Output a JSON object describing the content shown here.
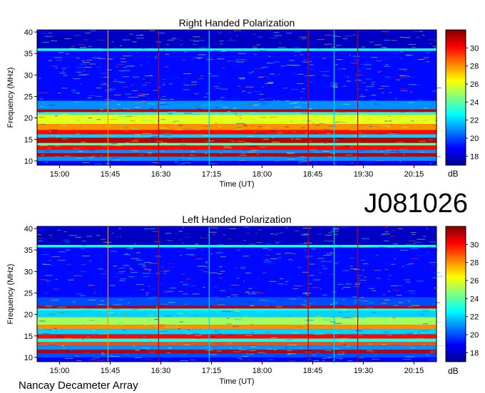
{
  "figure": {
    "observation_id": "J081026",
    "observatory": "Nancay Decameter Array"
  },
  "colorbar": {
    "label": "dB",
    "ticks": [
      18,
      20,
      22,
      24,
      26,
      28,
      30
    ],
    "range": [
      17,
      32
    ],
    "colormap": "jet"
  },
  "chart_data": [
    {
      "type": "heatmap",
      "title": "Right Handed Polarization",
      "xlabel": "Time (UT)",
      "ylabel": "Frequency (MHz)",
      "x_ticks": [
        "15:00",
        "15:45",
        "16:30",
        "17:15",
        "18:00",
        "18:45",
        "19:30",
        "20:15"
      ],
      "x_tick_minutes": [
        900,
        945,
        990,
        1035,
        1080,
        1125,
        1170,
        1215
      ],
      "xlim_minutes": [
        880,
        1235
      ],
      "y_ticks": [
        10,
        15,
        20,
        25,
        30,
        35,
        40
      ],
      "ylim": [
        9,
        40.5
      ],
      "value_unit": "dB",
      "frequency_bands": [
        {
          "fmin": 10.0,
          "fmax": 11.0,
          "dB": 21
        },
        {
          "fmin": 11.0,
          "fmax": 11.8,
          "dB": 31
        },
        {
          "fmin": 11.8,
          "fmax": 12.6,
          "dB": 21
        },
        {
          "fmin": 12.6,
          "fmax": 13.6,
          "dB": 30
        },
        {
          "fmin": 13.6,
          "fmax": 14.2,
          "dB": 24
        },
        {
          "fmin": 14.2,
          "fmax": 15.4,
          "dB": 31
        },
        {
          "fmin": 15.4,
          "fmax": 16.2,
          "dB": 22
        },
        {
          "fmin": 16.2,
          "fmax": 17.2,
          "dB": 30
        },
        {
          "fmin": 17.2,
          "fmax": 18.6,
          "dB": 28
        },
        {
          "fmin": 18.6,
          "fmax": 20.8,
          "dB": 26
        },
        {
          "fmin": 20.8,
          "fmax": 21.4,
          "dB": 23
        },
        {
          "fmin": 21.4,
          "fmax": 22.0,
          "dB": 31
        },
        {
          "fmin": 22.0,
          "fmax": 24.0,
          "dB": 21
        },
        {
          "fmin": 24.0,
          "fmax": 35.6,
          "dB": 19
        },
        {
          "fmin": 35.6,
          "fmax": 36.2,
          "dB": 23
        },
        {
          "fmin": 36.2,
          "fmax": 40.0,
          "dB": 18
        }
      ],
      "vertical_lines_minutes": [
        {
          "t": 943,
          "dB": 28
        },
        {
          "t": 988,
          "dB": 31
        },
        {
          "t": 1033,
          "dB": 22
        },
        {
          "t": 1121,
          "dB": 31
        },
        {
          "t": 1144,
          "dB": 22
        },
        {
          "t": 1165,
          "dB": 31
        }
      ]
    },
    {
      "type": "heatmap",
      "title": "Left Handed Polarization",
      "xlabel": "Time (UT)",
      "ylabel": "Frequency (MHz)",
      "x_ticks": [
        "15:00",
        "15:45",
        "16:30",
        "17:15",
        "18:00",
        "18:45",
        "19:30",
        "20:15"
      ],
      "x_tick_minutes": [
        900,
        945,
        990,
        1035,
        1080,
        1125,
        1170,
        1215
      ],
      "xlim_minutes": [
        880,
        1235
      ],
      "y_ticks": [
        10,
        15,
        20,
        25,
        30,
        35,
        40
      ],
      "ylim": [
        9,
        40.5
      ],
      "value_unit": "dB",
      "frequency_bands": [
        {
          "fmin": 10.0,
          "fmax": 11.0,
          "dB": 20
        },
        {
          "fmin": 11.0,
          "fmax": 11.8,
          "dB": 31
        },
        {
          "fmin": 11.8,
          "fmax": 12.8,
          "dB": 21
        },
        {
          "fmin": 12.8,
          "fmax": 13.6,
          "dB": 29
        },
        {
          "fmin": 13.6,
          "fmax": 14.4,
          "dB": 23
        },
        {
          "fmin": 14.4,
          "fmax": 15.4,
          "dB": 30
        },
        {
          "fmin": 15.4,
          "fmax": 16.6,
          "dB": 22
        },
        {
          "fmin": 16.6,
          "fmax": 17.6,
          "dB": 28
        },
        {
          "fmin": 17.6,
          "fmax": 19.4,
          "dB": 25
        },
        {
          "fmin": 19.4,
          "fmax": 20.8,
          "dB": 22
        },
        {
          "fmin": 20.8,
          "fmax": 21.4,
          "dB": 23
        },
        {
          "fmin": 21.4,
          "fmax": 22.0,
          "dB": 31
        },
        {
          "fmin": 22.0,
          "fmax": 24.0,
          "dB": 20
        },
        {
          "fmin": 24.0,
          "fmax": 35.6,
          "dB": 19
        },
        {
          "fmin": 35.6,
          "fmax": 36.2,
          "dB": 23
        },
        {
          "fmin": 36.2,
          "fmax": 40.0,
          "dB": 18
        }
      ],
      "vertical_lines_minutes": [
        {
          "t": 943,
          "dB": 28
        },
        {
          "t": 988,
          "dB": 31
        },
        {
          "t": 1033,
          "dB": 22
        },
        {
          "t": 1121,
          "dB": 31
        },
        {
          "t": 1144,
          "dB": 22
        },
        {
          "t": 1165,
          "dB": 31
        }
      ]
    }
  ]
}
